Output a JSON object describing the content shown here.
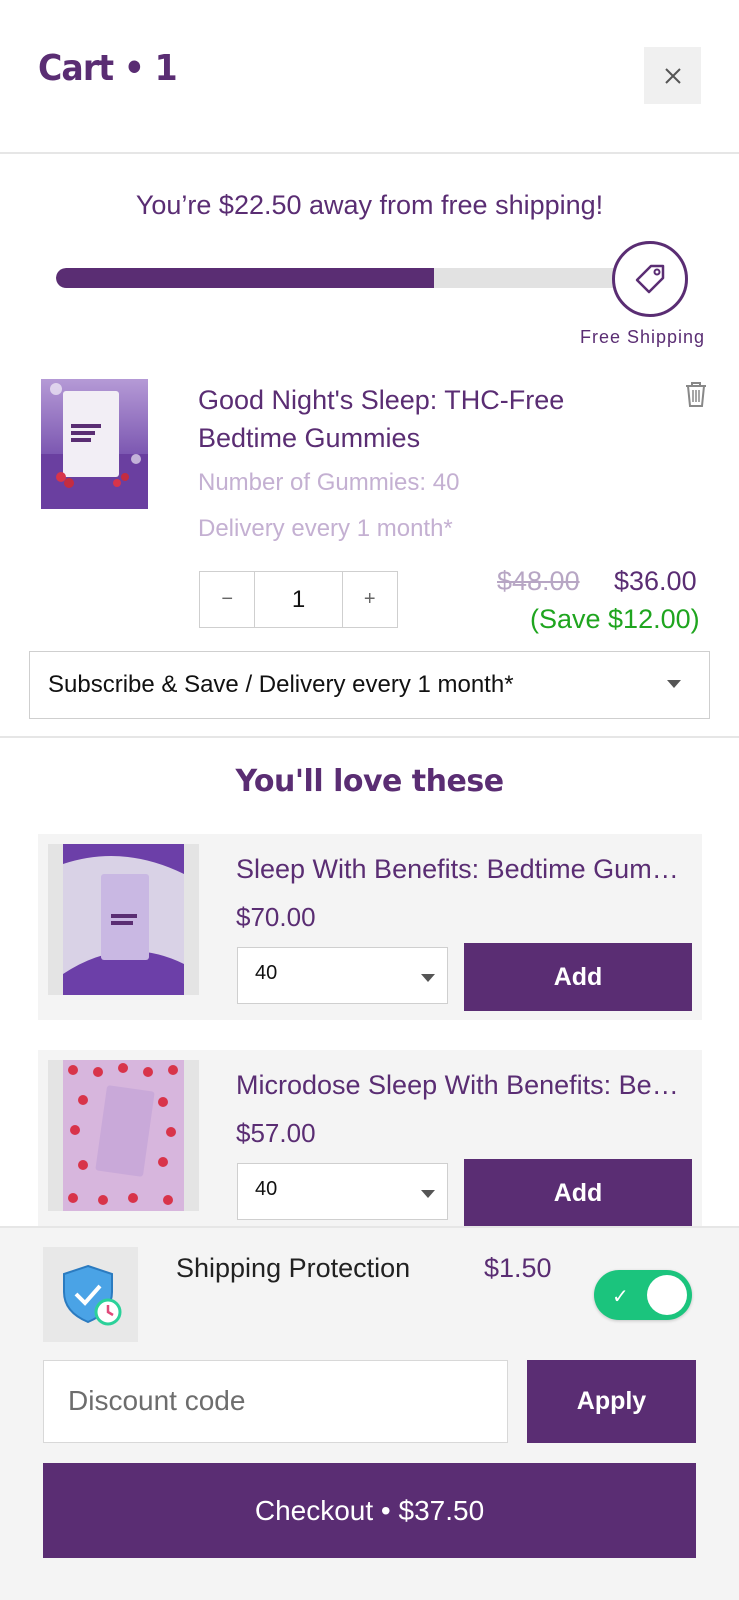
{
  "header": {
    "title": "Cart • 1",
    "close_icon": "close-icon"
  },
  "shipping_bar": {
    "message_prefix": "You’re ",
    "amount": "$22.50",
    "message_suffix": " away from free shipping!",
    "progress_fraction": 0.64,
    "goal_icon": "tag-icon",
    "goal_label": "Free Shipping"
  },
  "cart_item": {
    "name": "Good Night's Sleep: THC-Free Bedtime Gummies",
    "option": "Number of Gummies: 40",
    "delivery": "Delivery every 1 month*",
    "quantity": "1",
    "minus": "−",
    "plus": "+",
    "original_price": "$48.00",
    "price": "$36.00",
    "savings": "(Save $12.00)",
    "subscription_select": "Subscribe & Save / Delivery every 1 month*",
    "remove_icon": "trash-icon"
  },
  "upsell": {
    "title": "You'll love these",
    "items": [
      {
        "name": "Sleep With Benefits: Bedtime Gummies",
        "price": "$70.00",
        "option": "40",
        "add_label": "Add"
      },
      {
        "name": "Microdose Sleep With Benefits: Bedtime Gummies",
        "price": "$57.00",
        "option": "40",
        "add_label": "Add"
      }
    ]
  },
  "footer": {
    "protection_label": "Shipping Protection",
    "protection_price": "$1.50",
    "protection_enabled": true,
    "protection_icon": "shield-check-icon",
    "discount_placeholder": "Discount code",
    "apply_label": "Apply",
    "checkout_label": "Checkout • $37.50"
  },
  "colors": {
    "brand": "#5a2d73",
    "save_green": "#1fa51f",
    "toggle_on": "#1bc47d"
  }
}
